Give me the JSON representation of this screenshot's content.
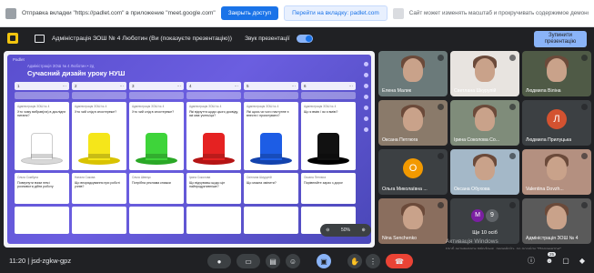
{
  "share_bar": {
    "message": "Отправка вкладки \"https://padlet.com\" в приложение \"meet.google.com\"",
    "stop_button": "Закрыть доступ",
    "goto_button": "Перейти на вкладку: padlet.com",
    "note": "Сайт может изменять масштаб и прокручивать содержимое демонстрируемых вкладок"
  },
  "meet_header": {
    "presenter_title": "Адміністрація ЗОШ № 4 Люботин (Ви (показуєте презентацію))",
    "audio_label": "Звук презентації",
    "stop_presenting": "Зупинити презентацію"
  },
  "padlet": {
    "brand": "Padlet",
    "author": "Адміністрація ЗОШ № 4 Люботин • 2д",
    "title": "Сучасний дизайн уроку НУШ",
    "columns": [
      {
        "num": "1",
        "author": "Адміністрація ЗОШ № 4",
        "question": "Хто чому вибрав(ла) в досліднє питаня?",
        "hat_color": "#ffffff",
        "hat_shade": "#d8d8d8",
        "note_author": "Ольга Сомбула",
        "note": "Повернути вчим нем і розповісти дійти роботу"
      },
      {
        "num": "2",
        "author": "Адміністрація ЗОШ № 4",
        "question": "Хто чий слід в спостереже?",
        "hat_color": "#f5e61a",
        "hat_shade": "#d9c300",
        "note_author": "Наталя Сакова",
        "note": "Що впорядкування при роботі учнів?"
      },
      {
        "num": "3",
        "author": "Адміністрація ЗОШ № 4",
        "question": "Хто чий слід в спостереже?",
        "hat_color": "#3ed43a",
        "hat_shade": "#2aa826",
        "note_author": "Ольга Шевчук",
        "note": "Потрібна реклама книжки"
      },
      {
        "num": "4",
        "author": "Адміністрація ЗОШ № 4",
        "question": "Які відчуття щодо цього досвіду, які має учень/ця?",
        "hat_color": "#e52222",
        "hat_shade": "#b51414",
        "note_author": "Ірина Соколова",
        "note": "Що відчуваєш щодо ціп найпродуктивніше?"
      },
      {
        "num": "5",
        "author": "Адміністрація ЗОШ № 4",
        "question": "Які щось чи чого наступне є внести і проєктувати?",
        "hat_color": "#1d5de5",
        "hat_shade": "#1343ad",
        "note_author": "Світлана Шкурупій",
        "note": "Що можна змінити?"
      },
      {
        "num": "6",
        "author": "Адміністрація ЗОШ № 4",
        "question": "Що я вмію / як я вмію?",
        "hat_color": "#111111",
        "hat_shade": "#000000",
        "note_author": "Оксана Петлюга",
        "note": "Порівнюйте зараз з дорог"
      }
    ],
    "zoom_level": "50%"
  },
  "participants": [
    {
      "name": "Елена Малик",
      "bg": "#6b7a7a"
    },
    {
      "name": "Светлана Шкурупій",
      "bg": "#e8e4e0"
    },
    {
      "name": "Людмила Віліна",
      "bg": "#4f5a46"
    },
    {
      "name": "Оксана Петлюга",
      "bg": "#8a7a6a"
    },
    {
      "name": "Ірина Соколова Со...",
      "bg": "#7f8c7a"
    },
    {
      "name": "Людмила Прилуцька",
      "bg": "#3c4043",
      "avatar": "Л",
      "avatar_color": "#d35230"
    },
    {
      "name": "Ольга Миколаївна ...",
      "bg": "#3c4043",
      "avatar": "O",
      "avatar_color": "#f29900"
    },
    {
      "name": "Оксана Обухова",
      "bg": "#a4b8c8"
    },
    {
      "name": "Valentina Dovzh...",
      "bg": "#b49080"
    },
    {
      "name": "Nina Senchenko",
      "bg": "#8a6e5e"
    },
    {
      "name": "Ще 10 осіб",
      "bg": "#3c4043",
      "more": [
        "M",
        "9"
      ]
    },
    {
      "name": "Адміністрація ЗОШ № 4",
      "bg": "#5a5a5a"
    }
  ],
  "watermark": {
    "line1": "Активація Windows",
    "line2": "Щоб активувати Windows, перейдіть до розділу \"Параметри\""
  },
  "controls": {
    "timecode": "11:20 | jsd-zgkw-gpz",
    "participants_badge": "25"
  }
}
